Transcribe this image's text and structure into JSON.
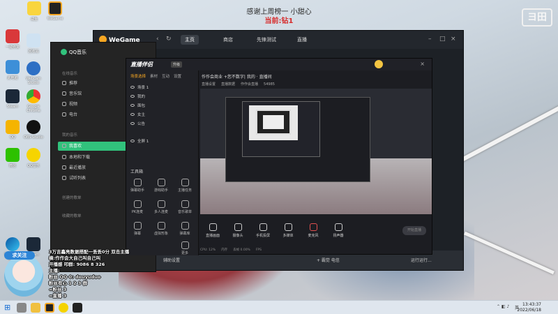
{
  "overlay": {
    "thanks": "感谢上周榜一 小甜心",
    "rank": "当前:钻1",
    "watermark": "ヨ田"
  },
  "desktop": {
    "icons": [
      {
        "label": "咸鱼",
        "icon": "app-icon"
      },
      {
        "label": "WeGame",
        "icon": "wegame-icon"
      },
      {
        "label": "一键修复",
        "icon": "app-icon"
      },
      {
        "label": "回收站",
        "icon": "recycle-bin-icon"
      },
      {
        "label": "此电脑",
        "icon": "computer-icon"
      },
      {
        "label": "Webcam Studio",
        "icon": "webcam-icon"
      },
      {
        "label": "Google Chrome",
        "icon": "chrome-icon"
      },
      {
        "label": "Steam",
        "icon": "steam-icon"
      },
      {
        "label": "OBS Studio",
        "icon": "obs-icon"
      },
      {
        "label": "QQ",
        "icon": "qq-icon"
      },
      {
        "label": "QQ音乐",
        "icon": "qq-music-icon"
      },
      {
        "label": "微信",
        "icon": "wechat-icon"
      },
      {
        "label": "Microsoft Edge",
        "icon": "edge-icon"
      },
      {
        "label": "Steam",
        "icon": "steam-icon"
      }
    ]
  },
  "wegame": {
    "logo": "WeGame",
    "nav": [
      "主页",
      "商店",
      "先锋测试",
      "直播"
    ],
    "bottom_left": "辅助设置",
    "bottom_mid": "+ 霸觉 电信",
    "bottom_right": "运行运行..."
  },
  "qq_music": {
    "title": "QQ音乐",
    "section_online": "在线音乐",
    "section_mine": "我的音乐",
    "section_created": "创建的歌单",
    "section_collected": "收藏的歌单",
    "online_items": [
      "推荐",
      "音乐馆",
      "视频",
      "电台"
    ],
    "mine_items": [
      "我喜欢",
      "本地和下载",
      "最近播放",
      "试听列表"
    ],
    "active_item": "我喜欢"
  },
  "live": {
    "app_name": "直播伴侣",
    "badge": "升级",
    "tabs": [
      "场景选择",
      "素材",
      "互动",
      "设置"
    ],
    "scenes": [
      "场景 1",
      "我的",
      "面包",
      "女主",
      "公告",
      "全屏 1"
    ],
    "tools_title": "工具箱",
    "tools": [
      "弹幕助手",
      "游戏助手",
      "主播任务",
      "PK连麦",
      "多人连麦",
      "音乐歌单",
      "弹幕",
      "虚拟形象",
      "弹幕库",
      "更多"
    ],
    "header_title": "作作会商业 +您不数字|",
    "header_extra": "我的 · 直播间",
    "sub_items": [
      "直播设置",
      "直播数据",
      "作作会直播",
      "54985"
    ],
    "controls": [
      "直播画面",
      "摄像头",
      "手机投屏",
      "多媒体",
      "麦克风",
      "扬声器"
    ],
    "go_live": "开始直播",
    "status": [
      "CPU: 12%",
      "内存",
      "丢帧 0.00%",
      "FPS"
    ]
  },
  "chat": {
    "follow": "求关注",
    "lines": [
      "3万吉鑫亮数据搭配一丢丢0分 双击主播",
      "横:作作会大自己叫自己叫",
      "开播感 叩群: 9086 8 326",
      "主播:",
      "粉丝 QQ 0: douyuduo",
      "粉丝有心 1 2 3 群",
      "=粉丝 3",
      "=直播 3"
    ]
  },
  "taskbar": {
    "time": "13:43:37",
    "date": "2022/06/18",
    "lang": "英"
  }
}
